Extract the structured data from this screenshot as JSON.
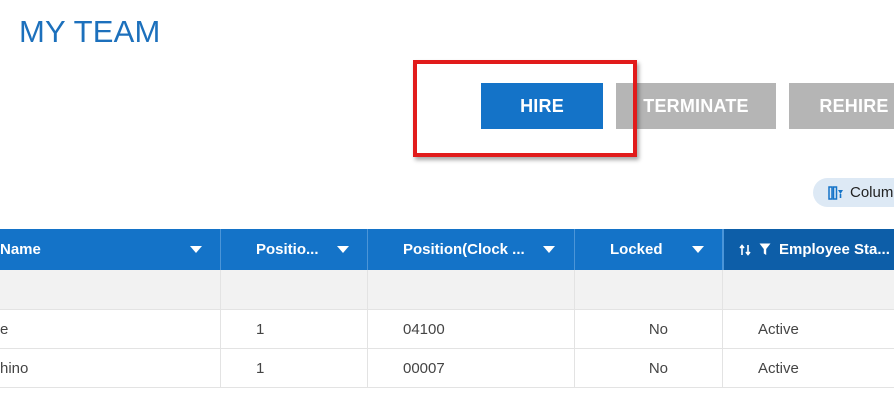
{
  "page": {
    "title": "MY TEAM"
  },
  "actions": {
    "hire": "HIRE",
    "terminate": "TERMINATE",
    "rehire": "REHIRE"
  },
  "toolbar": {
    "columns_label": "Colum"
  },
  "grid": {
    "headers": {
      "name": "Name",
      "position": "Positio...",
      "position_clock": "Position(Clock ...",
      "locked": "Locked",
      "employee_status": "Employee Sta..."
    },
    "rows": [
      {
        "name": "e",
        "position": "1",
        "position_clock": "04100",
        "locked": "No",
        "employee_status": "Active"
      },
      {
        "name": "hino",
        "position": "1",
        "position_clock": "00007",
        "locked": "No",
        "employee_status": "Active"
      }
    ]
  },
  "colors": {
    "accent": "#1473c8",
    "title": "#1c70bc",
    "disabled": "#b5b5b5",
    "highlight": "#e11b1b"
  },
  "icons": [
    "columns-icon",
    "sort-icon",
    "filter-icon",
    "caret-down-icon"
  ]
}
